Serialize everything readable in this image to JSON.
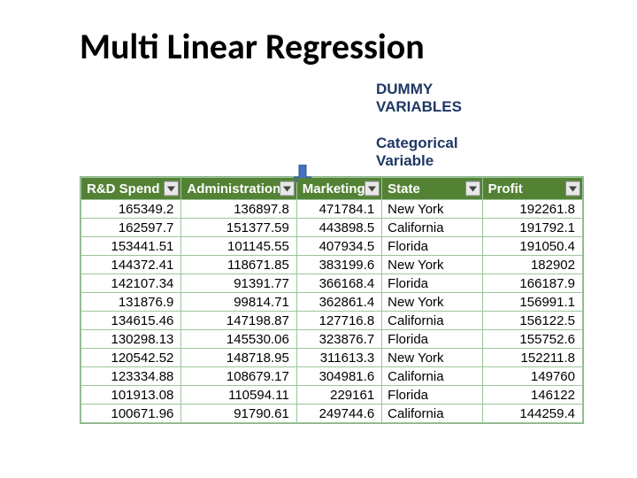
{
  "title": "Multi Linear Regression",
  "subheading_l1": "DUMMY",
  "subheading_l2": "VARIABLES",
  "callout_l1": "Categorical",
  "callout_l2": "Variable",
  "headers": {
    "rd": "R&D Spend",
    "admin": "Administration",
    "mkt": "Marketing",
    "state": "State",
    "profit": "Profit"
  },
  "rows": [
    {
      "rd": "165349.2",
      "admin": "136897.8",
      "mkt": "471784.1",
      "state": "New York",
      "profit": "192261.8"
    },
    {
      "rd": "162597.7",
      "admin": "151377.59",
      "mkt": "443898.5",
      "state": "California",
      "profit": "191792.1"
    },
    {
      "rd": "153441.51",
      "admin": "101145.55",
      "mkt": "407934.5",
      "state": "Florida",
      "profit": "191050.4"
    },
    {
      "rd": "144372.41",
      "admin": "118671.85",
      "mkt": "383199.6",
      "state": "New York",
      "profit": "182902"
    },
    {
      "rd": "142107.34",
      "admin": "91391.77",
      "mkt": "366168.4",
      "state": "Florida",
      "profit": "166187.9"
    },
    {
      "rd": "131876.9",
      "admin": "99814.71",
      "mkt": "362861.4",
      "state": "New York",
      "profit": "156991.1"
    },
    {
      "rd": "134615.46",
      "admin": "147198.87",
      "mkt": "127716.8",
      "state": "California",
      "profit": "156122.5"
    },
    {
      "rd": "130298.13",
      "admin": "145530.06",
      "mkt": "323876.7",
      "state": "Florida",
      "profit": "155752.6"
    },
    {
      "rd": "120542.52",
      "admin": "148718.95",
      "mkt": "311613.3",
      "state": "New York",
      "profit": "152211.8"
    },
    {
      "rd": "123334.88",
      "admin": "108679.17",
      "mkt": "304981.6",
      "state": "California",
      "profit": "149760"
    },
    {
      "rd": "101913.08",
      "admin": "110594.11",
      "mkt": "229161",
      "state": "Florida",
      "profit": "146122"
    },
    {
      "rd": "100671.96",
      "admin": "91790.61",
      "mkt": "249744.6",
      "state": "California",
      "profit": "144259.4"
    }
  ],
  "chart_data": {
    "type": "table",
    "title": "Multi Linear Regression",
    "columns": [
      "R&D Spend",
      "Administration",
      "Marketing",
      "State",
      "Profit"
    ],
    "rows": [
      [
        165349.2,
        136897.8,
        471784.1,
        "New York",
        192261.8
      ],
      [
        162597.7,
        151377.59,
        443898.5,
        "California",
        191792.1
      ],
      [
        153441.51,
        101145.55,
        407934.5,
        "Florida",
        191050.4
      ],
      [
        144372.41,
        118671.85,
        383199.6,
        "New York",
        182902
      ],
      [
        142107.34,
        91391.77,
        366168.4,
        "Florida",
        166187.9
      ],
      [
        131876.9,
        99814.71,
        362861.4,
        "New York",
        156991.1
      ],
      [
        134615.46,
        147198.87,
        127716.8,
        "California",
        156122.5
      ],
      [
        130298.13,
        145530.06,
        323876.7,
        "Florida",
        155752.6
      ],
      [
        120542.52,
        148718.95,
        311613.3,
        "New York",
        152211.8
      ],
      [
        123334.88,
        108679.17,
        304981.6,
        "California",
        149760
      ],
      [
        101913.08,
        110594.11,
        229161,
        "Florida",
        146122
      ],
      [
        100671.96,
        91790.61,
        249744.6,
        "California",
        144259.4
      ]
    ]
  }
}
